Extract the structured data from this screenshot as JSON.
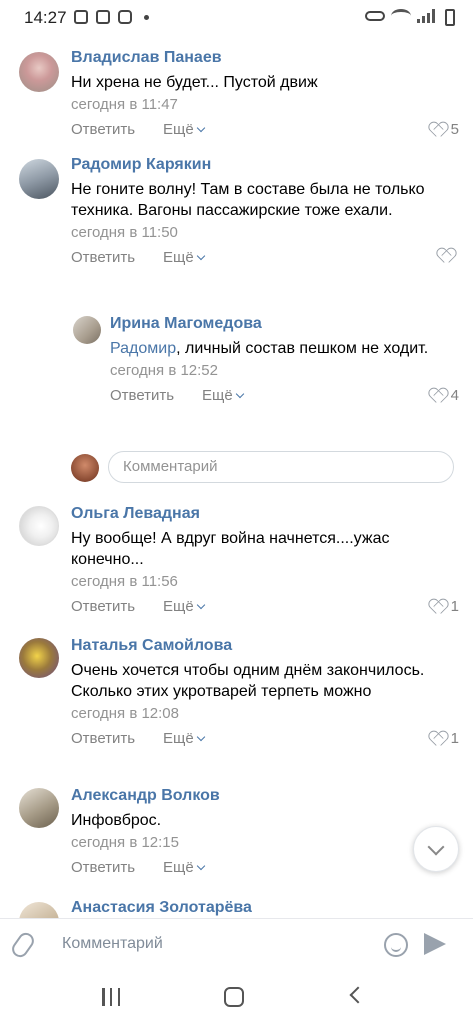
{
  "status_bar": {
    "time": "14:27"
  },
  "actions": {
    "reply_label": "Ответить",
    "more_label": "Ещё"
  },
  "comments": [
    {
      "author": "Владислав Панаев",
      "text": "Ни хрена не будет... Пустой движ",
      "time": "сегодня в 11:47",
      "likes": "5"
    },
    {
      "author": "Радомир Карякин",
      "text": "Не гоните волну! Там в составе была не только техника. Вагоны пассажирские тоже ехали.",
      "time": "сегодня в 11:50",
      "likes": ""
    },
    {
      "author": "Ирина Магомедова",
      "mention": "Радомир",
      "text": ", личный состав пешком не ходит.",
      "time": "сегодня в 12:52",
      "likes": "4"
    },
    {
      "author": "Ольга Левадная",
      "text": "Ну вообще! А вдруг война начнется....ужас конечно...",
      "time": "сегодня в 11:56",
      "likes": "1"
    },
    {
      "author": "Наталья Самойлова",
      "text": "Очень хочется чтобы одним днём закончилось. Сколько этих укротварей терпеть можно",
      "time": "сегодня в 12:08",
      "likes": "1"
    },
    {
      "author": "Александр Волков",
      "text": "Инфовброс.",
      "time": "сегодня в 12:15",
      "likes": ""
    },
    {
      "author": "Анастасия Золотарёва"
    }
  ],
  "reply_input": {
    "placeholder": "Комментарий"
  },
  "composer": {
    "placeholder": "Комментарий"
  }
}
